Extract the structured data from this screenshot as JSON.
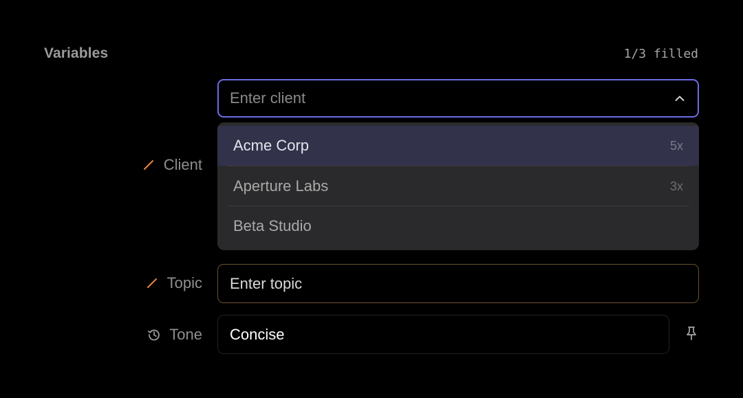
{
  "header": {
    "title": "Variables",
    "fill_status": "1/3 filled"
  },
  "fields": {
    "client": {
      "label": "Client",
      "icon": "pencil-icon",
      "placeholder": "Enter client",
      "value": "",
      "dropdown_open": true,
      "options": [
        {
          "label": "Acme Corp",
          "count": "5x",
          "highlighted": true
        },
        {
          "label": "Aperture Labs",
          "count": "3x",
          "highlighted": false
        },
        {
          "label": "Beta Studio",
          "count": "",
          "highlighted": false
        }
      ]
    },
    "topic": {
      "label": "Topic",
      "icon": "pencil-icon",
      "placeholder": "Enter topic",
      "value": ""
    },
    "tone": {
      "label": "Tone",
      "icon": "history-icon",
      "value": "Concise",
      "pin_icon": "pin-icon"
    }
  },
  "colors": {
    "background": "#000000",
    "focus_border": "#6c6ce6",
    "unfilled_accent": "#e8873a",
    "highlight_row": "#32324a",
    "dropdown_bg": "#2a2a2c"
  }
}
